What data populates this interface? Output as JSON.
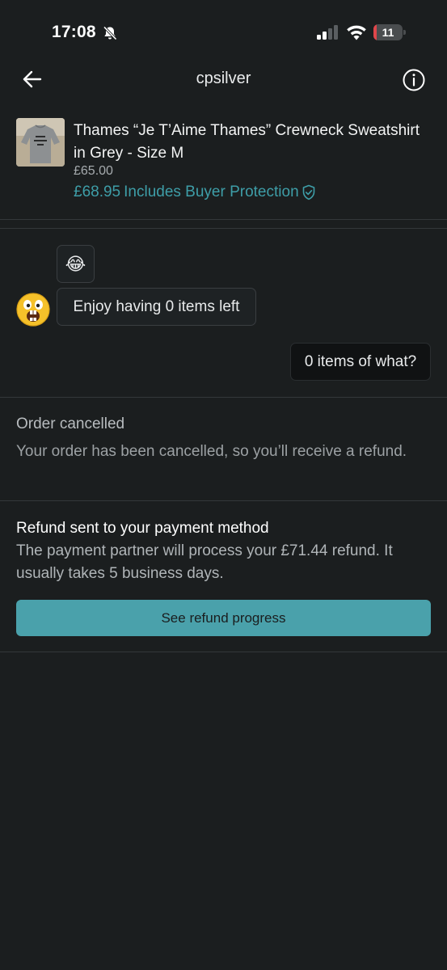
{
  "status_bar": {
    "time": "17:08",
    "battery": "11",
    "battery_level": 0.11,
    "icons": [
      "bell-slash-icon",
      "signal-icon",
      "wifi-icon",
      "battery-icon"
    ]
  },
  "header": {
    "title": "cpsilver",
    "icons": [
      "back-arrow-icon",
      "info-icon"
    ]
  },
  "product": {
    "title": "Thames “Je T’Aime Thames” Crewneck Sweatshirt in Grey - Size M",
    "price": "£65.00",
    "price_with_protection": "£68.95",
    "protection_label": "Includes Buyer Protection",
    "accent_color": "#3e9ea8"
  },
  "chat": {
    "messages": [
      {
        "from": "other",
        "text": "😂"
      },
      {
        "from": "other",
        "text": "Enjoy having 0 items left"
      },
      {
        "from": "me",
        "text": "0 items of what?"
      }
    ]
  },
  "order_status": {
    "title": "Order cancelled",
    "text": "Your order has been cancelled, so you’ll receive a refund."
  },
  "refund": {
    "title": "Refund sent to your payment method",
    "text": "The payment partner will process your £71.44 refund. It usually takes 5 business days.",
    "button_label": "See refund progress",
    "button_color": "#4aa1ab"
  }
}
